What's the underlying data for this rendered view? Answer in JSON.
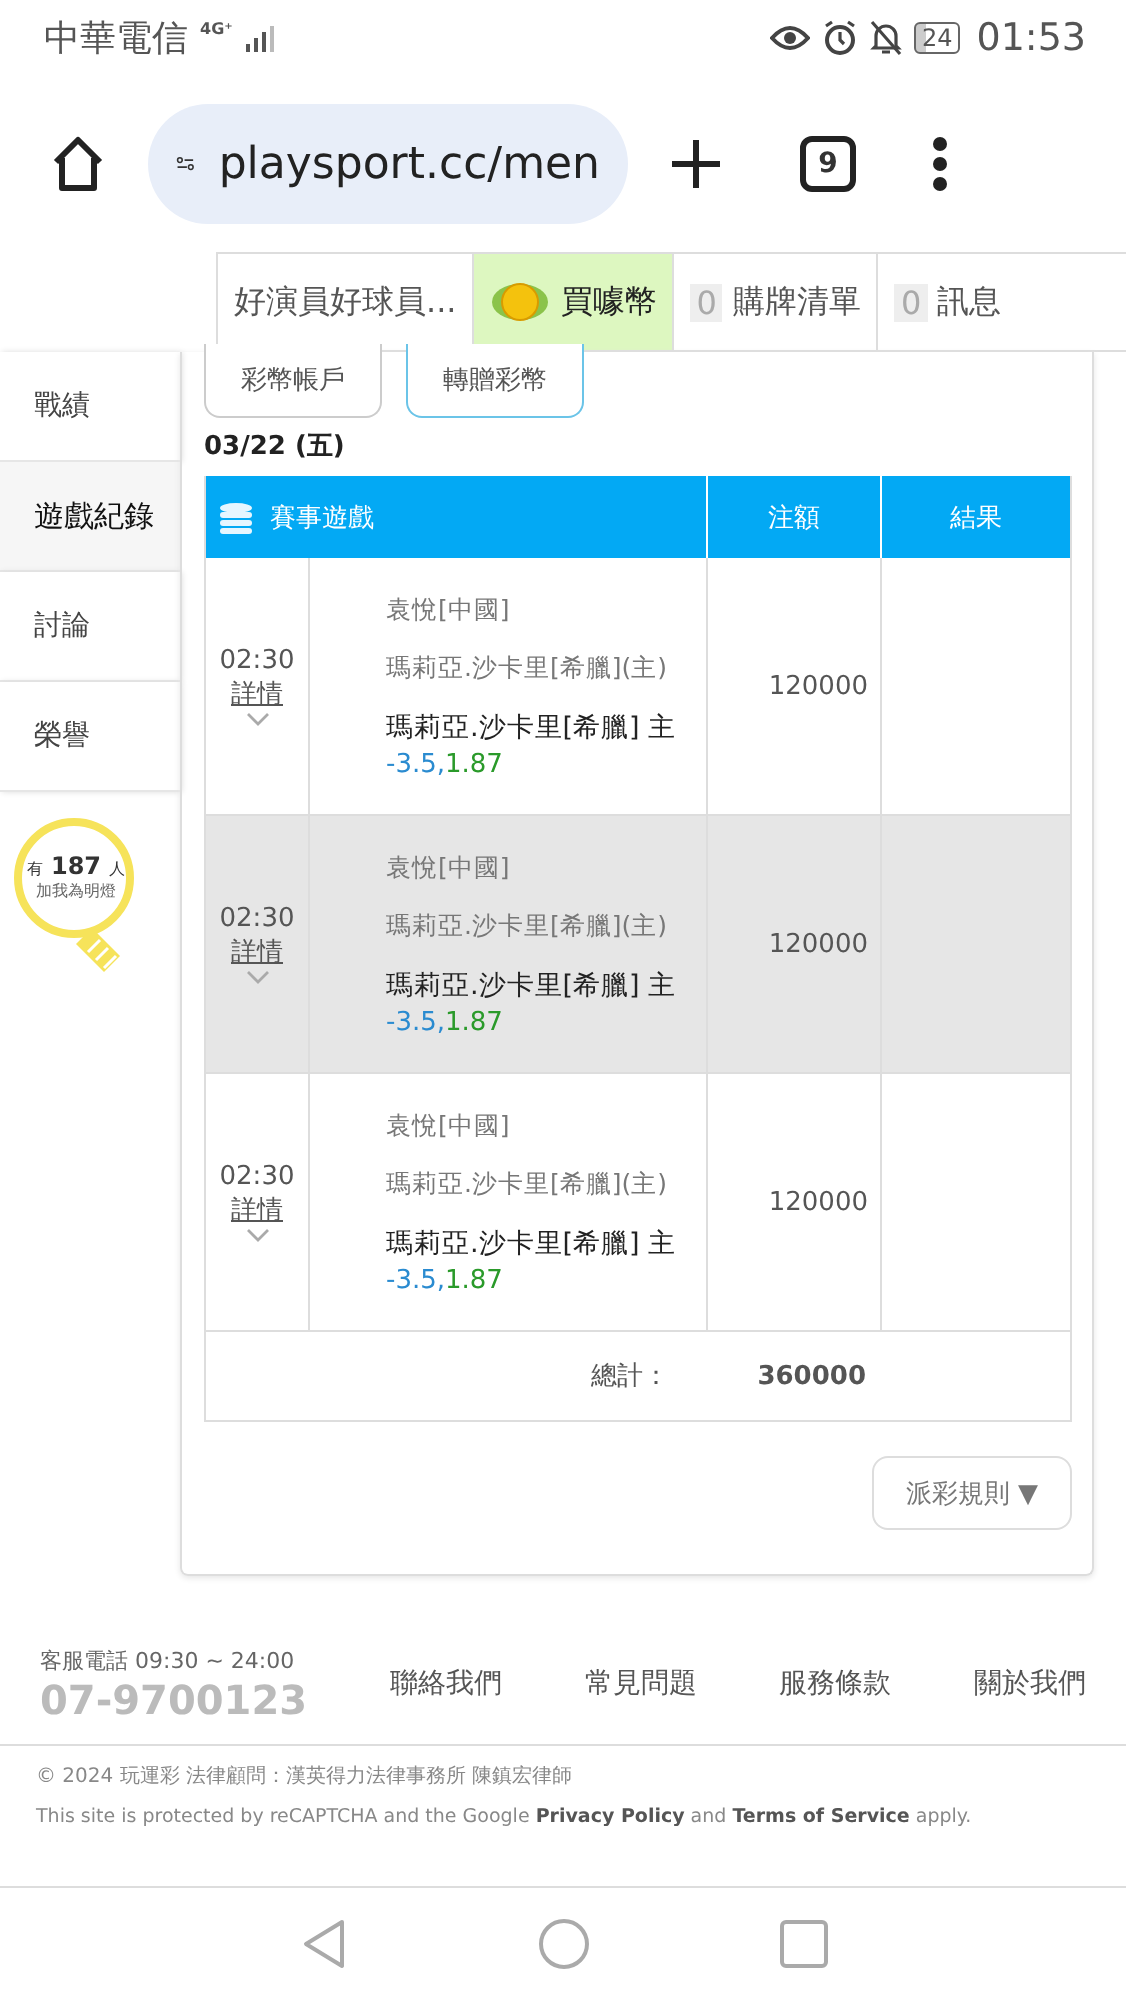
{
  "status_bar": {
    "carrier": "中華電信",
    "network": "4G⁺",
    "battery": "24",
    "time": "01:53"
  },
  "browser": {
    "url": "playsport.cc/men",
    "tab_count": "9"
  },
  "top_nav": [
    {
      "kind": "user",
      "label": "好演員好球員..."
    },
    {
      "kind": "coin",
      "label": "買噱幣"
    },
    {
      "kind": "count",
      "count": "0",
      "label": "購牌清單"
    },
    {
      "kind": "count",
      "count": "0",
      "label": "訊息"
    }
  ],
  "sidebar": {
    "items": [
      {
        "label": "戰績",
        "selected": false
      },
      {
        "label": "遊戲紀錄",
        "selected": true
      },
      {
        "label": "討論",
        "selected": false
      },
      {
        "label": "榮譽",
        "selected": false
      }
    ],
    "fans": {
      "prefix": "有",
      "count": "187",
      "suffix": "人",
      "caption": "加我為明燈"
    }
  },
  "tabs": [
    {
      "label": "彩幣帳戶",
      "selected": false
    },
    {
      "label": "轉贈彩幣",
      "selected": true
    }
  ],
  "date": "03/22 (五)",
  "table": {
    "columns": [
      "賽事遊戲",
      "注額",
      "結果"
    ],
    "rows": [
      {
        "time": "02:30",
        "link": "詳情",
        "player": "袁悅[中國]",
        "opponent": "瑪莉亞.沙卡里[希臘](主)",
        "pick": "瑪莉亞.沙卡里[希臘] 主",
        "line": "-3.5,",
        "odds": "1.87",
        "amount": "120000",
        "highlighted": false
      },
      {
        "time": "02:30",
        "link": "詳情",
        "player": "袁悅[中國]",
        "opponent": "瑪莉亞.沙卡里[希臘](主)",
        "pick": "瑪莉亞.沙卡里[希臘] 主",
        "line": "-3.5,",
        "odds": "1.87",
        "amount": "120000",
        "highlighted": true
      },
      {
        "time": "02:30",
        "link": "詳情",
        "player": "袁悅[中國]",
        "opponent": "瑪莉亞.沙卡里[希臘](主)",
        "pick": "瑪莉亞.沙卡里[希臘] 主",
        "line": "-3.5,",
        "odds": "1.87",
        "amount": "120000",
        "highlighted": false
      }
    ],
    "total_label": "總計：",
    "total": "360000"
  },
  "rules_button": "派彩規則 ▼",
  "footer": {
    "hours": "客服電話 09:30 ~ 24:00",
    "phone": "07-9700123",
    "links": [
      "聯絡我們",
      "常見問題",
      "服務條款",
      "關於我們"
    ],
    "copyright": "© 2024 玩運彩 法律顧問：漢英得力法律事務所 陳鎮宏律師",
    "recaptcha": "This site is protected by reCAPTCHA and the Google **Privacy Policy** and **Terms of Service** apply."
  }
}
